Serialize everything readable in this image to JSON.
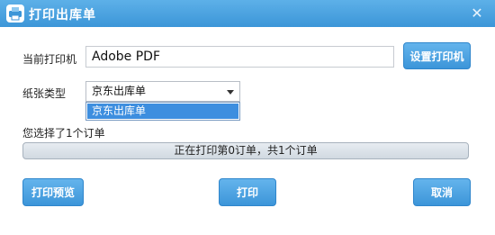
{
  "window": {
    "title": "打印出库单",
    "close_glyph": "✕"
  },
  "form": {
    "printer_label": "当前打印机",
    "printer_value": "Adobe PDF",
    "setup_printer_label": "设置打印机",
    "paper_type_label": "纸张类型",
    "paper_type_selected": "京东出库单",
    "paper_type_options": [
      "京东出库单"
    ]
  },
  "status": {
    "selection_text": "您选择了1个订单",
    "progress_text": "正在打印第0订单，共1个订单",
    "progress_fraction": 0
  },
  "buttons": {
    "preview": "打印预览",
    "print": "打印",
    "cancel": "取消"
  },
  "colors": {
    "accent": "#3c96d8",
    "selected": "#3d8edf"
  }
}
